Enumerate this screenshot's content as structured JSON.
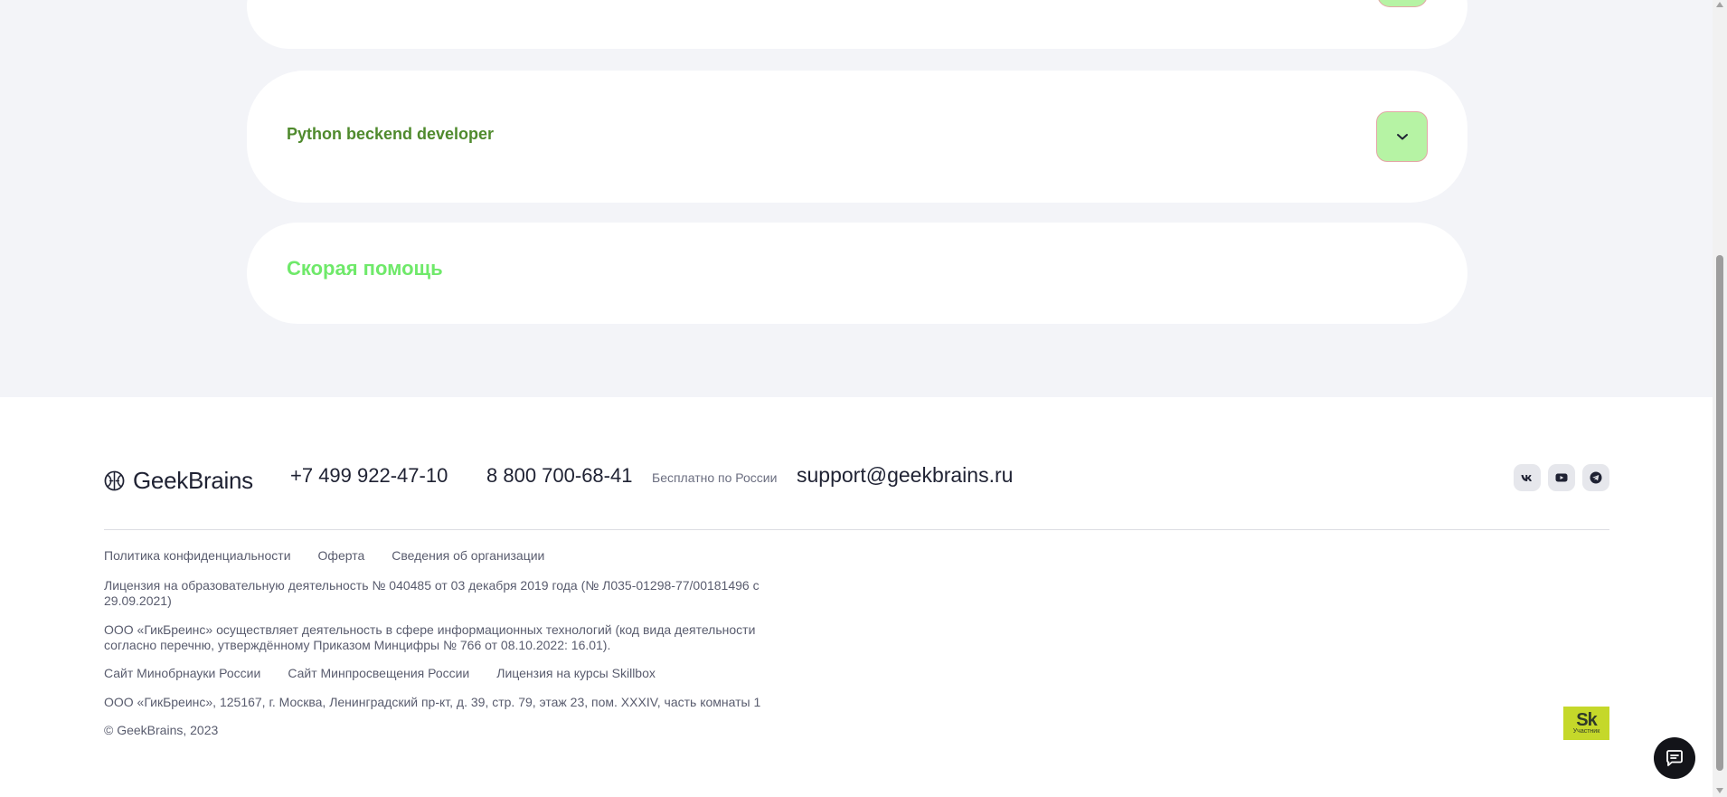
{
  "faq": {
    "python_title": "Python beckend developer",
    "help_title": "Скорая помощь"
  },
  "footer": {
    "logo_text": "GeekBrains",
    "phone1": "+7 499 922-47-10",
    "phone2": "8 800 700-68-41",
    "phone2_note": "Бесплатно по России",
    "email": "support@geekbrains.ru",
    "social_icons": [
      "vk-icon",
      "youtube-icon",
      "telegram-icon"
    ],
    "links_row1": [
      "Политика конфиденциальности",
      "Оферта",
      "Сведения об организации"
    ],
    "license_text": "Лицензия на образовательную деятельность № 040485 от 03 декабря 2019 года (№ Л035-01298-77/00181496 с 29.09.2021)",
    "ooo_text": "ООО «ГикБреинс» осуществляет деятельность в сфере информационных технологий (код вида деятельности согласно перечню, утверждённому Приказом Минцифры № 766 от 08.10.2022: 16.01).",
    "links_row2": [
      "Сайт Минобрнауки России",
      "Сайт Минпросвещения России",
      "Лицензия на курсы Skillbox"
    ],
    "address_text": "ООО «ГикБреинс», 125167, г. Москва, Ленинградский пр-кт, д. 39, стр. 79, этаж 23, пом. XXXIV, часть комнаты 1",
    "copyright": "© GeekBrains, 2023",
    "badge_sk": "Sk",
    "badge_sub": "Участник"
  },
  "colors": {
    "accent_green": "#6fe96a",
    "button_green": "#b6f3a4",
    "title_dark_green": "#4f8a2d",
    "page_bg": "#f3f4f8",
    "badge_lime": "#c5d82a"
  }
}
